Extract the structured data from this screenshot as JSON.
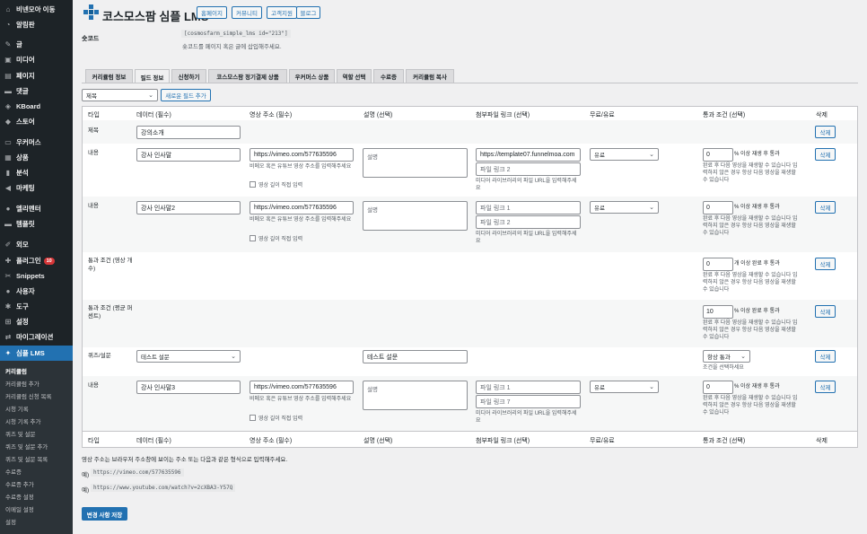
{
  "sidebar": {
    "items": [
      {
        "label": "비넨모아 이동",
        "icon": "home-icon"
      },
      {
        "label": "알림판",
        "icon": "dashboard-icon"
      },
      {
        "label": "글",
        "icon": "pin-icon"
      },
      {
        "label": "미디어",
        "icon": "media-icon"
      },
      {
        "label": "페이지",
        "icon": "page-icon"
      },
      {
        "label": "댓글",
        "icon": "comment-icon"
      },
      {
        "label": "KBoard",
        "icon": "kboard-icon"
      },
      {
        "label": "스토어",
        "icon": "store-icon"
      },
      {
        "label": "우커머스",
        "icon": "woo-icon"
      },
      {
        "label": "상품",
        "icon": "product-icon"
      },
      {
        "label": "분석",
        "icon": "chart-icon"
      },
      {
        "label": "마케팅",
        "icon": "megaphone-icon"
      },
      {
        "label": "엘리멘터",
        "icon": "elementor-icon"
      },
      {
        "label": "템플릿",
        "icon": "folder-icon"
      },
      {
        "label": "외모",
        "icon": "brush-icon"
      },
      {
        "label": "플러그인",
        "icon": "plugin-icon",
        "badge": "10"
      },
      {
        "label": "Snippets",
        "icon": "snippets-icon"
      },
      {
        "label": "사용자",
        "icon": "user-icon"
      },
      {
        "label": "도구",
        "icon": "wrench-icon"
      },
      {
        "label": "설정",
        "icon": "settings-icon"
      },
      {
        "label": "마이그레이션",
        "icon": "migrate-icon"
      },
      {
        "label": "심플 LMS",
        "icon": "lms-icon"
      }
    ],
    "submenu": [
      "커리큘럼",
      "커리큘럼 추가",
      "커리큘럼 신청 목록",
      "시청 기록",
      "시청 기록 추가",
      "퀴즈 및 설문",
      "퀴즈 및 설문 추가",
      "퀴즈 및 설문 목록",
      "수료증",
      "수료증 추가",
      "수료증 설정",
      "이메일 설정",
      "설정"
    ]
  },
  "header": {
    "title": "코스모스팜 심플 LMS",
    "buttons": [
      "홈페이지",
      "커뮤니티",
      "고객지원",
      "블로그"
    ]
  },
  "shortcode": {
    "label": "숏코드",
    "code": "[cosmosfarm_simple_lms id=\"213\"]",
    "desc": "숏코드를 페이지 혹은 글에 삽입해주세요."
  },
  "tabs": [
    "커리큘럼 정보",
    "필드 정보",
    "신청하기",
    "코스모스팜 정기결제 상품",
    "우커머스 상품",
    "역할 선택",
    "수료증",
    "커리큘럼 복사"
  ],
  "field_type_select": "제목",
  "add_field_button": "새로운 필드 추가",
  "columns": [
    "타입",
    "데이터 (필수)",
    "영상 주소 (필수)",
    "설명 (선택)",
    "첨부파일 링크 (선택)",
    "무료/유료",
    "통과 조건 (선택)",
    "삭제"
  ],
  "rows": {
    "title": {
      "type": "제목",
      "value": "강의소개"
    },
    "c1": {
      "type": "내용",
      "data": "강사 인사말",
      "url": "https://vimeo.com/577635596",
      "url_hint": "비메오 혹은 유튜브 영상 주소를 입력해주세요",
      "check": "영상 길이 직접 입력",
      "desc": "설명",
      "file1": "https://template07.funnelmoa.com",
      "file2": "파일 링크 2",
      "file_hint": "미디어 라이브러리의 파일 URL을 입력해주세요",
      "paid": "유료",
      "pass_value": "0",
      "pass_unit": "% 이상 재생 후 통과",
      "pass_hint": "완료 후 다음 영상을 재생할 수 있습니다 입력하지 않은 경우 항상 다음 영상을 재생할 수 있습니다"
    },
    "c2": {
      "type": "내용",
      "data": "강사 인사말2",
      "url": "https://vimeo.com/577635596",
      "url_hint": "비메오 혹은 유튜브 영상 주소를 입력해주세요",
      "check": "영상 길이 직접 입력",
      "desc": "설명",
      "file1": "파일 링크 1",
      "file2": "파일 링크 2",
      "file_hint": "미디어 라이브러리의 파일 URL을 입력해주세요",
      "paid": "유료",
      "pass_value": "0",
      "pass_unit": "% 이상 재생 후 통과",
      "pass_hint": "완료 후 다음 영상을 재생할 수 있습니다 입력하지 않은 경우 항상 다음 영상을 재생할 수 있습니다"
    },
    "p1": {
      "type": "통과 조건 (영상 개수)",
      "pass_value": "0",
      "pass_unit": "개 이상 완료 후 통과",
      "pass_hint": "완료 후 다음 영상을 재생할 수 있습니다 입력하지 않은 경우 항상 다음 영상을 재생할 수 있습니다"
    },
    "p2": {
      "type": "통과 조건 (평균 퍼센트)",
      "pass_value": "10",
      "pass_unit": "% 이상 완료 후 통과",
      "pass_hint": "완료 후 다음 영상을 재생할 수 있습니다 입력하지 않은 경우 항상 다음 영상을 재생할 수 있습니다"
    },
    "q": {
      "type": "퀴즈/설문",
      "select": "테스트 설문",
      "desc": "테스트 설문",
      "pass_select": "항상 통과",
      "pass_hint": "조건을 선택하세요"
    },
    "c3": {
      "type": "내용",
      "data": "강사 인사말3",
      "url": "https://vimeo.com/577635596",
      "url_hint": "비메오 혹은 유튜브 영상 주소를 입력해주세요",
      "check": "영상 길이 직접 입력",
      "desc": "설명",
      "file1": "파일 링크 1",
      "file2": "파일 링크 7",
      "file_hint": "미디어 라이브러리의 파일 URL을 입력해주세요",
      "paid": "유료",
      "pass_value": "0",
      "pass_unit": "% 이상 재생 후 통과",
      "pass_hint": "완료 후 다음 영상을 재생할 수 있습니다 입력하지 않은 경우 항상 다음 영상을 재생할 수 있습니다"
    }
  },
  "delete_label": "삭제",
  "footer": {
    "note": "영상 주소는 브라우저 주소창에 보이는 주소 또는 다음과 같은 형식으로 입력해주세요.",
    "ex_label": "예)",
    "ex1": "https://vimeo.com/577635596",
    "ex2": "https://www.youtube.com/watch?v=2cXBA3-Y57Q",
    "save": "변경 사항 저장"
  }
}
